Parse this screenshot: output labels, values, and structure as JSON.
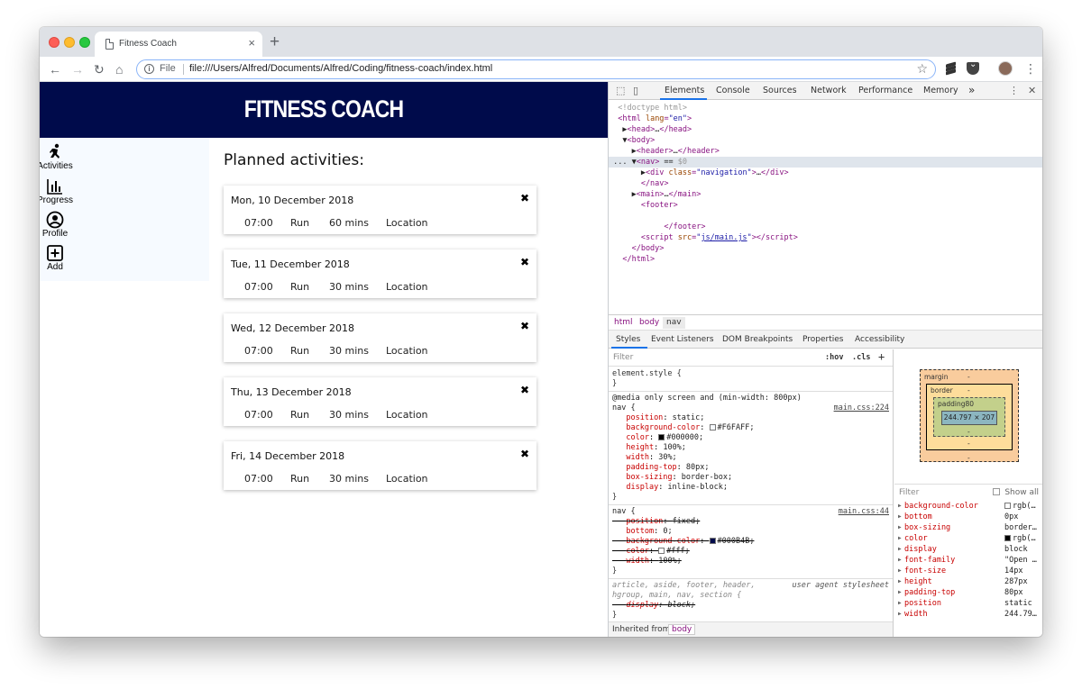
{
  "browser": {
    "tab_title": "Fitness Coach",
    "tab_close": "×",
    "new_tab": "+",
    "url_scheme": "File",
    "url": "file:///Users/Alfred/Documents/Alfred/Coding/fitness-coach/index.html",
    "icons": [
      "back-icon",
      "forward-icon",
      "reload-icon",
      "home-icon",
      "star-icon",
      "layers-icon",
      "pocket-icon",
      "avatar-icon",
      "menu-icon"
    ]
  },
  "site": {
    "title": "FITNESS COACH",
    "header_color": "#000B4B",
    "nav_bg": "#F6FAFF",
    "nav": [
      {
        "label": "Activities",
        "icon": "running-icon"
      },
      {
        "label": "Progress",
        "icon": "bar-chart-icon"
      },
      {
        "label": "Profile",
        "icon": "user-circle-icon"
      },
      {
        "label": "Add",
        "icon": "add-square-icon"
      }
    ],
    "planned_title": "Planned activities:",
    "remove_glyph": "✖",
    "activities": [
      {
        "date": "Mon, 10 December 2018",
        "time": "07:00",
        "type": "Run",
        "duration": "60 mins",
        "location": "Location"
      },
      {
        "date": "Tue, 11 December 2018",
        "time": "07:00",
        "type": "Run",
        "duration": "30 mins",
        "location": "Location"
      },
      {
        "date": "Wed, 12 December 2018",
        "time": "07:00",
        "type": "Run",
        "duration": "30 mins",
        "location": "Location"
      },
      {
        "date": "Thu, 13 December 2018",
        "time": "07:00",
        "type": "Run",
        "duration": "30 mins",
        "location": "Location"
      },
      {
        "date": "Fri, 14 December 2018",
        "time": "07:00",
        "type": "Run",
        "duration": "30 mins",
        "location": "Location"
      }
    ]
  },
  "devtools": {
    "tabs": [
      "Elements",
      "Console",
      "Sources",
      "Network",
      "Performance",
      "Memory"
    ],
    "more": "»",
    "breadcrumbs": [
      "html",
      "body",
      "nav"
    ],
    "subtabs": [
      "Styles",
      "Event Listeners",
      "DOM Breakpoints",
      "Properties",
      "Accessibility"
    ],
    "styles_filter": "Filter",
    "hov": ":hov",
    "cls": ".cls",
    "plus": "+",
    "element_style": "element.style {",
    "media_rule": "@media only screen and (min-width: 800px)",
    "nav_selector": "nav {",
    "close_brace": "}",
    "src1": "main.css:224",
    "src2": "main.css:44",
    "ua_label": "user agent stylesheet",
    "ua_selector_1": "article, aside, footer, header,",
    "ua_selector_2": "hgroup, main, nav, section {",
    "inherited_from": "Inherited from",
    "inherited_body": "body",
    "box": {
      "margin": "margin",
      "border": "border",
      "padding": "padding80",
      "content": "244.797 × 207",
      "dash": "-"
    },
    "computed_filter": "Filter",
    "show_all": "Show all"
  }
}
